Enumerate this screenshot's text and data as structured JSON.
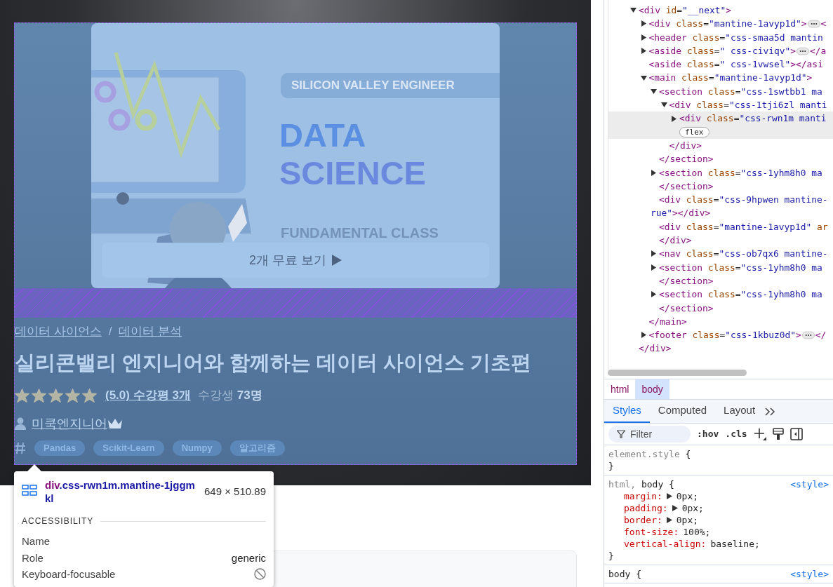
{
  "course_page": {
    "thumbnail": {
      "tagline": "SILICON VALLEY ENGINEER",
      "headline": [
        "DATA",
        "SCIENCE"
      ],
      "subtitle": "FUNDAMENTAL CLASS"
    },
    "preview_button": "2개 무료 보기",
    "breadcrumb": {
      "items": [
        "데이터 사이언스",
        "데이터 분석"
      ],
      "separator": "/"
    },
    "title": "실리콘밸리 엔지니어와 함께하는 데이터 사이언스 기초편",
    "stars": 5,
    "rating_link": "(5.0) 수강평 3개",
    "students_label": "수강생",
    "students_count": "73명",
    "instructor": "미쿡엔지니어",
    "tags": [
      "Pandas",
      "Scikit-Learn",
      "Numpy",
      "알고리즘"
    ]
  },
  "tooltip": {
    "element": "div",
    "classes": ".css-rwn1m.mantine-1jggmkl",
    "size": "649 × 510.89",
    "section": "ACCESSIBILITY",
    "name_label": "Name",
    "role_label": "Role",
    "role": "generic",
    "focusable_label": "Keyboard-focusable",
    "focusable": false
  },
  "devtools": {
    "dom_tree": [
      {
        "expanded": true,
        "selected": false,
        "line": [
          {
            "kind": "tag",
            "text": "<div"
          },
          {
            "kind": "attr",
            "text": " id"
          },
          {
            "kind": "punct",
            "text": "="
          },
          {
            "kind": "value",
            "text": "\"__next\""
          },
          {
            "kind": "tag",
            "text": ">"
          }
        ],
        "close": [
          {
            "kind": "tag",
            "text": "</div>"
          }
        ],
        "children": [
          {
            "expanded": false,
            "selected": false,
            "line": [
              {
                "kind": "tag",
                "text": "<div"
              },
              {
                "kind": "attr",
                "text": " class"
              },
              {
                "kind": "punct",
                "text": "="
              },
              {
                "kind": "value",
                "text": "\"mantine-1avyp1d\""
              },
              {
                "kind": "tag",
                "text": ">"
              },
              {
                "kind": "ellipsis"
              },
              {
                "kind": "tag",
                "text": "<"
              }
            ]
          },
          {
            "expanded": false,
            "selected": false,
            "line": [
              {
                "kind": "tag",
                "text": "<header"
              },
              {
                "kind": "attr",
                "text": " class"
              },
              {
                "kind": "punct",
                "text": "="
              },
              {
                "kind": "value",
                "text": "\"css-smaa5d mantin"
              }
            ]
          },
          {
            "expanded": false,
            "selected": false,
            "line": [
              {
                "kind": "tag",
                "text": "<aside"
              },
              {
                "kind": "attr",
                "text": " class"
              },
              {
                "kind": "punct",
                "text": "="
              },
              {
                "kind": "value",
                "text": "\" css-civiqv\""
              },
              {
                "kind": "tag",
                "text": ">"
              },
              {
                "kind": "ellipsis"
              },
              {
                "kind": "tag",
                "text": "</a"
              }
            ]
          },
          {
            "selected": false,
            "line": [
              {
                "kind": "tag",
                "text": "<aside"
              },
              {
                "kind": "attr",
                "text": " class"
              },
              {
                "kind": "punct",
                "text": "="
              },
              {
                "kind": "value",
                "text": "\" css-1vwsel\""
              },
              {
                "kind": "tag",
                "text": "></asi"
              }
            ]
          },
          {
            "expanded": true,
            "selected": false,
            "line": [
              {
                "kind": "tag",
                "text": "<main"
              },
              {
                "kind": "attr",
                "text": " class"
              },
              {
                "kind": "punct",
                "text": "="
              },
              {
                "kind": "value",
                "text": "\"mantine-1avyp1d\""
              },
              {
                "kind": "tag",
                "text": ">"
              }
            ],
            "close": [
              {
                "kind": "tag",
                "text": "</main>"
              }
            ],
            "children": [
              {
                "expanded": true,
                "selected": false,
                "line": [
                  {
                    "kind": "tag",
                    "text": "<section"
                  },
                  {
                    "kind": "attr",
                    "text": " class"
                  },
                  {
                    "kind": "punct",
                    "text": "="
                  },
                  {
                    "kind": "value",
                    "text": "\"css-1swtbb1 ma"
                  }
                ],
                "close": [
                  {
                    "kind": "tag",
                    "text": "</section>"
                  }
                ],
                "children": [
                  {
                    "expanded": true,
                    "selected": false,
                    "line": [
                      {
                        "kind": "tag",
                        "text": "<div"
                      },
                      {
                        "kind": "attr",
                        "text": " class"
                      },
                      {
                        "kind": "punct",
                        "text": "="
                      },
                      {
                        "kind": "value",
                        "text": "\"css-1tji6zl manti"
                      }
                    ],
                    "close": [
                      {
                        "kind": "tag",
                        "text": "</div>"
                      }
                    ],
                    "children": [
                      {
                        "expanded": false,
                        "selected": true,
                        "line": [
                          {
                            "kind": "tag",
                            "text": "<div"
                          },
                          {
                            "kind": "attr",
                            "text": " class"
                          },
                          {
                            "kind": "punct",
                            "text": "="
                          },
                          {
                            "kind": "value",
                            "text": "\"css-rwn1m manti"
                          }
                        ],
                        "badge": "flex"
                      }
                    ]
                  }
                ]
              },
              {
                "expanded": false,
                "selected": false,
                "line": [
                  {
                    "kind": "tag",
                    "text": "<section"
                  },
                  {
                    "kind": "attr",
                    "text": " class"
                  },
                  {
                    "kind": "punct",
                    "text": "="
                  },
                  {
                    "kind": "value",
                    "text": "\"css-1yhm8h0 ma"
                  }
                ],
                "close": [
                  {
                    "kind": "tag",
                    "text": "</section>"
                  }
                ]
              },
              {
                "selected": false,
                "line": [
                  {
                    "kind": "tag",
                    "text": "<div"
                  },
                  {
                    "kind": "attr",
                    "text": " class"
                  },
                  {
                    "kind": "punct",
                    "text": "="
                  },
                  {
                    "kind": "value",
                    "text": "\"css-9hpwen mantine-"
                  }
                ],
                "line2": [
                  {
                    "kind": "value",
                    "text": "rue\""
                  },
                  {
                    "kind": "tag",
                    "text": "></div>"
                  }
                ]
              },
              {
                "selected": false,
                "line": [
                  {
                    "kind": "tag",
                    "text": "<div"
                  },
                  {
                    "kind": "attr",
                    "text": " class"
                  },
                  {
                    "kind": "punct",
                    "text": "="
                  },
                  {
                    "kind": "value",
                    "text": "\"mantine-1avyp1d\""
                  },
                  {
                    "kind": "attr",
                    "text": " ar"
                  }
                ],
                "close": [
                  {
                    "kind": "tag",
                    "text": "</div>"
                  }
                ]
              },
              {
                "expanded": false,
                "selected": false,
                "line": [
                  {
                    "kind": "tag",
                    "text": "<nav"
                  },
                  {
                    "kind": "attr",
                    "text": " class"
                  },
                  {
                    "kind": "punct",
                    "text": "="
                  },
                  {
                    "kind": "value",
                    "text": "\"css-ob7qx6 mantine-"
                  }
                ]
              },
              {
                "expanded": false,
                "selected": false,
                "line": [
                  {
                    "kind": "tag",
                    "text": "<section"
                  },
                  {
                    "kind": "attr",
                    "text": " class"
                  },
                  {
                    "kind": "punct",
                    "text": "="
                  },
                  {
                    "kind": "value",
                    "text": "\"css-1yhm8h0 ma"
                  }
                ],
                "close": [
                  {
                    "kind": "tag",
                    "text": "</section>"
                  }
                ]
              },
              {
                "expanded": false,
                "selected": false,
                "line": [
                  {
                    "kind": "tag",
                    "text": "<section"
                  },
                  {
                    "kind": "attr",
                    "text": " class"
                  },
                  {
                    "kind": "punct",
                    "text": "="
                  },
                  {
                    "kind": "value",
                    "text": "\"css-1yhm8h0 ma"
                  }
                ],
                "close": [
                  {
                    "kind": "tag",
                    "text": "</section>"
                  }
                ]
              }
            ]
          },
          {
            "expanded": false,
            "selected": false,
            "line": [
              {
                "kind": "tag",
                "text": "<footer"
              },
              {
                "kind": "attr",
                "text": " class"
              },
              {
                "kind": "punct",
                "text": "="
              },
              {
                "kind": "value",
                "text": "\"css-1kbuz0d\""
              },
              {
                "kind": "tag",
                "text": ">"
              },
              {
                "kind": "ellipsis"
              },
              {
                "kind": "tag",
                "text": "</"
              }
            ]
          }
        ]
      }
    ],
    "breadcrumbs": [
      {
        "label": "html",
        "selected": false
      },
      {
        "label": "body",
        "selected": true
      }
    ],
    "tabs": [
      {
        "label": "Styles",
        "selected": true
      },
      {
        "label": "Computed",
        "selected": false
      },
      {
        "label": "Layout",
        "selected": false
      }
    ],
    "filter": {
      "placeholder": "Filter"
    },
    "toolbar": [
      ":hov",
      ".cls"
    ],
    "rules": [
      {
        "selector": [
          {
            "text": "element.style",
            "matched": false
          }
        ],
        "open": "{",
        "close": "}"
      },
      {
        "selector": [
          {
            "text": "html,",
            "matched": false
          },
          {
            "text": "body",
            "matched": true
          }
        ],
        "open": "{",
        "close": "}",
        "source": "<style>",
        "declarations": [
          {
            "property": "margin:",
            "value": "0px;",
            "expandable": true
          },
          {
            "property": "padding:",
            "value": "0px;",
            "expandable": true
          },
          {
            "property": "border:",
            "value": "0px;",
            "expandable": true
          },
          {
            "property": "font-size:",
            "value": "100%;",
            "expandable": false
          },
          {
            "property": "vertical-align:",
            "value": "baseline;",
            "expandable": false
          }
        ]
      },
      {
        "selector": [
          {
            "text": "body",
            "matched": true
          }
        ],
        "open": "{",
        "source": "<style>"
      }
    ]
  }
}
